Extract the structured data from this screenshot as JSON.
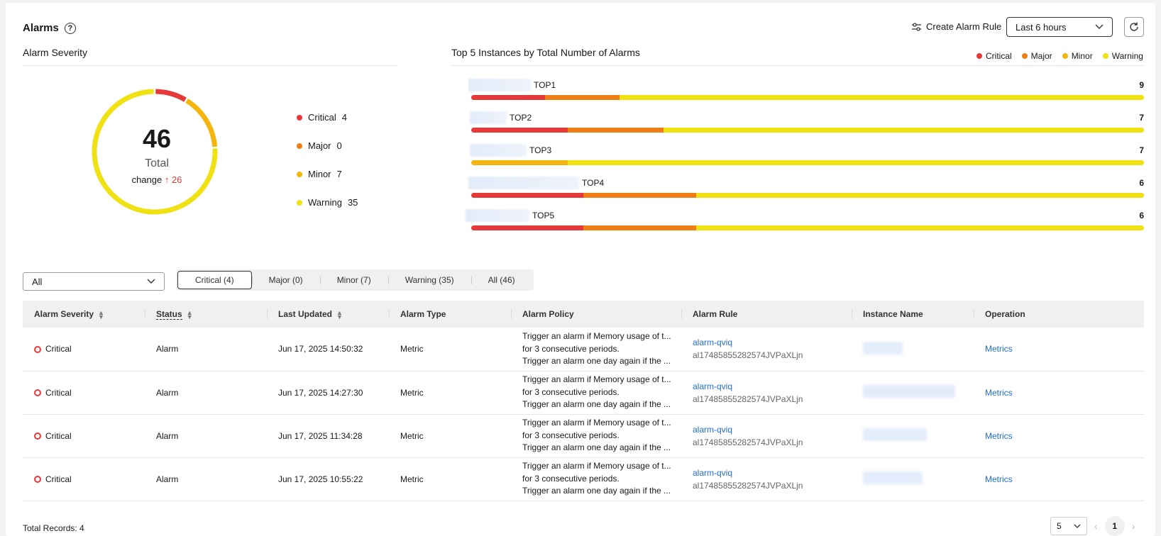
{
  "header": {
    "title": "Alarms",
    "create_rule_label": "Create Alarm Rule",
    "time_range": "Last 6 hours"
  },
  "severity": {
    "section_title": "Alarm Severity",
    "total": "46",
    "total_label": "Total",
    "change_label": "change",
    "change_value": "↑ 26",
    "items": [
      {
        "label": "Critical",
        "count": "4",
        "color": "#e63a3a"
      },
      {
        "label": "Major",
        "count": "0",
        "color": "#f07e16"
      },
      {
        "label": "Minor",
        "count": "7",
        "color": "#f5b50f"
      },
      {
        "label": "Warning",
        "count": "35",
        "color": "#f0e113"
      }
    ]
  },
  "top5": {
    "section_title": "Top 5 Instances by Total Number of Alarms",
    "legend": [
      "Critical",
      "Major",
      "Minor",
      "Warning"
    ],
    "rows": [
      {
        "name": "TOP1",
        "count": "9",
        "critical": 0.11,
        "major": 0.11,
        "minor": 0,
        "warning": 0.78
      },
      {
        "name": "TOP2",
        "count": "7",
        "critical": 0.143,
        "major": 0.143,
        "minor": 0,
        "warning": 0.714
      },
      {
        "name": "TOP3",
        "count": "7",
        "critical": 0,
        "major": 0,
        "minor": 0.143,
        "warning": 0.857
      },
      {
        "name": "TOP4",
        "count": "6",
        "critical": 0.167,
        "major": 0.167,
        "minor": 0,
        "warning": 0.666
      },
      {
        "name": "TOP5",
        "count": "6",
        "critical": 0.167,
        "major": 0.167,
        "minor": 0,
        "warning": 0.666
      }
    ]
  },
  "filter": {
    "select_value": "All",
    "tabs": [
      "Critical (4)",
      "Major (0)",
      "Minor (7)",
      "Warning (35)",
      "All (46)"
    ]
  },
  "table": {
    "headers": [
      "Alarm Severity",
      "Status",
      "Last Updated",
      "Alarm Type",
      "Alarm Policy",
      "Alarm Rule",
      "Instance Name",
      "Operation"
    ],
    "rows": [
      {
        "severity": "Critical",
        "status": "Alarm",
        "updated": "Jun 17, 2025 14:50:32",
        "type": "Metric",
        "policy": [
          "Trigger an alarm if Memory usage of t...",
          "for 3 consecutive periods.",
          "Trigger an alarm one day again if the ..."
        ],
        "rule_name": "alarm-qviq",
        "rule_id": "al17485855282574JVPaXLjn",
        "operation": "Metrics"
      },
      {
        "severity": "Critical",
        "status": "Alarm",
        "updated": "Jun 17, 2025 14:27:30",
        "type": "Metric",
        "policy": [
          "Trigger an alarm if Memory usage of t...",
          "for 3 consecutive periods.",
          "Trigger an alarm one day again if the ..."
        ],
        "rule_name": "alarm-qviq",
        "rule_id": "al17485855282574JVPaXLjn",
        "operation": "Metrics"
      },
      {
        "severity": "Critical",
        "status": "Alarm",
        "updated": "Jun 17, 2025 11:34:28",
        "type": "Metric",
        "policy": [
          "Trigger an alarm if Memory usage of t...",
          "for 3 consecutive periods.",
          "Trigger an alarm one day again if the ..."
        ],
        "rule_name": "alarm-qviq",
        "rule_id": "al17485855282574JVPaXLjn",
        "operation": "Metrics"
      },
      {
        "severity": "Critical",
        "status": "Alarm",
        "updated": "Jun 17, 2025 10:55:22",
        "type": "Metric",
        "policy": [
          "Trigger an alarm if Memory usage of t...",
          "for 3 consecutive periods.",
          "Trigger an alarm one day again if the ..."
        ],
        "rule_name": "alarm-qviq",
        "rule_id": "al17485855282574JVPaXLjn",
        "operation": "Metrics"
      }
    ]
  },
  "footer": {
    "total_records": "Total Records: 4",
    "page_size": "5",
    "current_page": "1"
  }
}
